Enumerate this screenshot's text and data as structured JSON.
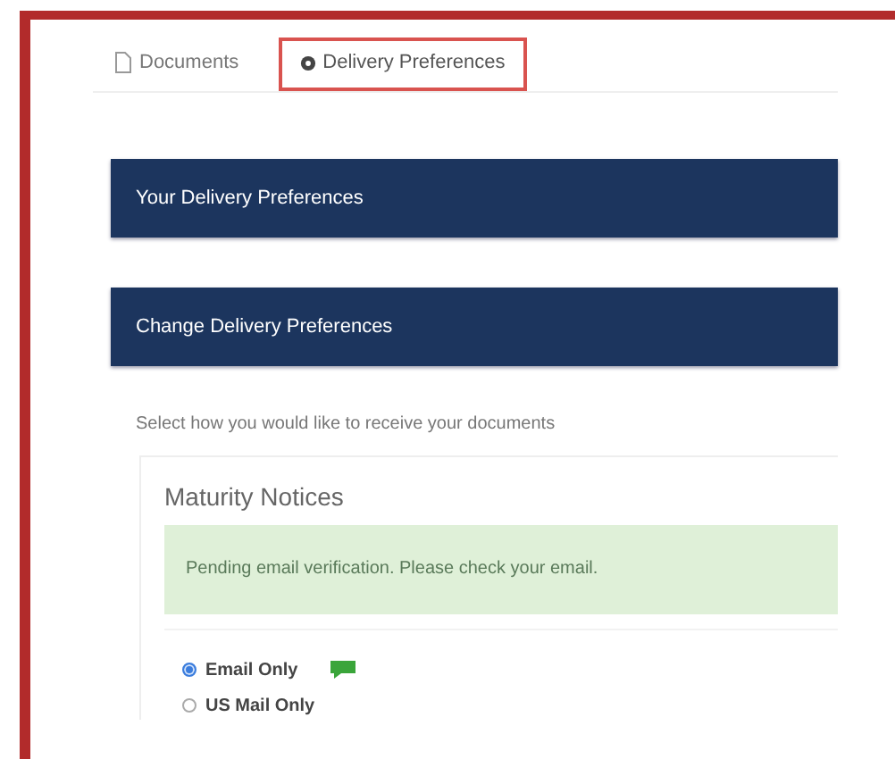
{
  "tabs": [
    {
      "label": "Documents",
      "kind": "document",
      "selected": false
    },
    {
      "label": "Delivery Preferences",
      "kind": "settings",
      "selected": true
    }
  ],
  "panels": [
    {
      "title": "Your Delivery Preferences"
    },
    {
      "title": "Change Delivery Preferences"
    }
  ],
  "instructions": "Select how you would like to receive your documents",
  "section": {
    "title": "Maturity Notices",
    "alert": "Pending email verification. Please check your email.",
    "options": [
      {
        "label": "Email Only",
        "selected": true,
        "verified_icon": true
      },
      {
        "label": "US Mail Only",
        "selected": false,
        "verified_icon": false
      }
    ]
  }
}
